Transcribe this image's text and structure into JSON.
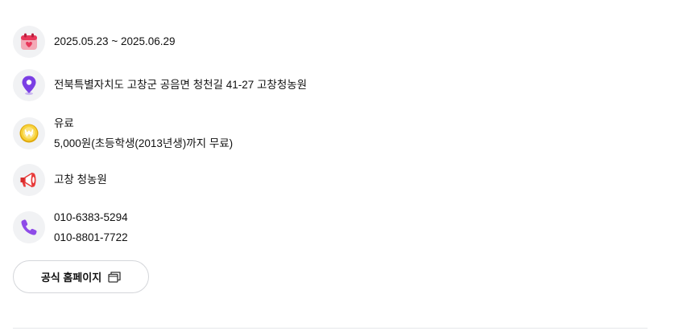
{
  "event": {
    "period": "2025.05.23 ~ 2025.06.29",
    "address": "전북특별자치도 고창군 공음면 청천길 41-27 고창청농원",
    "fee": {
      "type": "유료",
      "detail": "5,000원(초등학생(2013년생)까지 무료)"
    },
    "host": "고창 청농원",
    "phones": [
      "010-6383-5294",
      "010-8801-7722"
    ]
  },
  "buttons": {
    "homepage_label": "공식 홈페이지"
  },
  "icons": {
    "period": "calendar-icon",
    "address": "location-pin-icon",
    "fee": "coin-icon",
    "host": "megaphone-icon",
    "phone": "phone-icon",
    "homepage": "new-window-icon"
  },
  "colors": {
    "calendar": "#e8375a",
    "pin": "#7b3fe4",
    "coin": "#f2c21b",
    "megaphone": "#e83a3a",
    "phone": "#8e4be8",
    "icon_bg": "#f1f2f4",
    "button_border": "#d4d6da"
  }
}
